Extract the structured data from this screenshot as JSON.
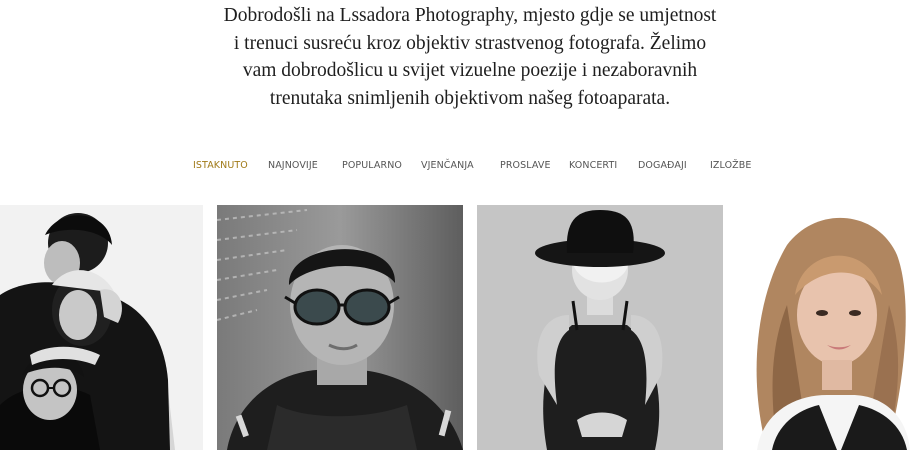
{
  "intro": {
    "lines": [
      "Dobrodošli na Lssadora Photography, mjesto gdje se umjetnost",
      "i trenuci susreću kroz objektiv strastvenog fotografa. Želimo",
      "vam dobrodošlicu u svijet vizuelne poezije i nezaboravnih",
      "trenutaka snimljenih objektivom našeg fotoaparata."
    ]
  },
  "tabs": {
    "active_color": "#a07a18",
    "items": [
      {
        "label": "ISTAKNUTO",
        "active": true
      },
      {
        "label": "NAJNOVIJE",
        "active": false
      },
      {
        "label": "POPULARNO",
        "active": false
      },
      {
        "label": "VJENČANJA",
        "active": false
      },
      {
        "label": "PROSLAVE",
        "active": false
      },
      {
        "label": "KONCERTI",
        "active": false
      },
      {
        "label": "DOGAĐAJI",
        "active": false
      },
      {
        "label": "IZLOŽBE",
        "active": false
      }
    ]
  },
  "gallery": {
    "photos": [
      {
        "subject": "three-people-stacked-portrait"
      },
      {
        "subject": "man-with-sunglasses-portrait"
      },
      {
        "subject": "woman-in-black-hat-portrait"
      },
      {
        "subject": "woman-with-wavy-hair-portrait"
      }
    ]
  }
}
